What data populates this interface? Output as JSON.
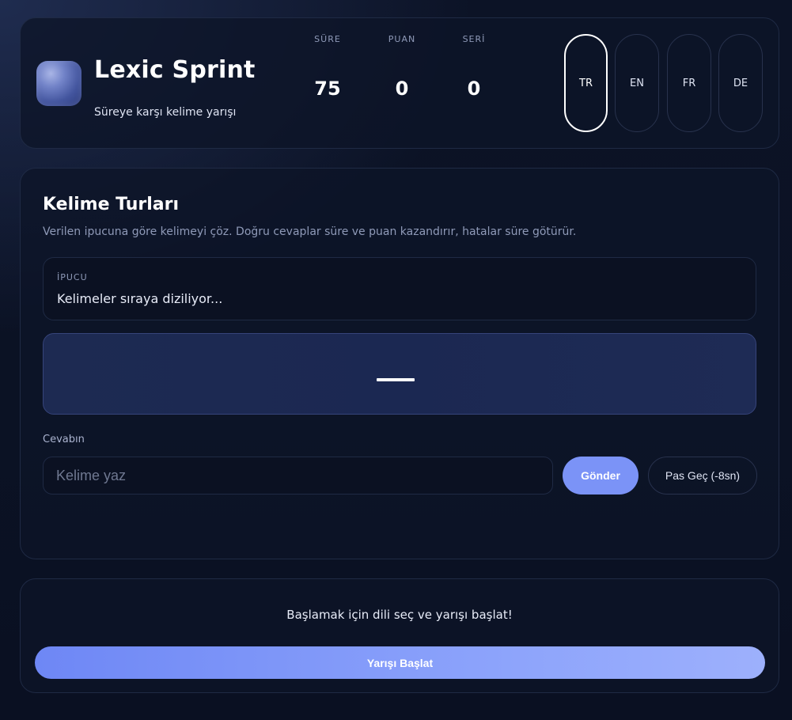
{
  "header": {
    "title": "Lexic Sprint",
    "subtitle": "Süreye karşı kelime yarışı",
    "logo": "gradient-orb-logo"
  },
  "stats": {
    "time": {
      "label": "SÜRE",
      "value": "75"
    },
    "score": {
      "label": "PUAN",
      "value": "0"
    },
    "streak": {
      "label": "SERİ",
      "value": "0"
    }
  },
  "languages": {
    "selected": "TR",
    "items": [
      "TR",
      "EN",
      "FR",
      "DE"
    ]
  },
  "game": {
    "title": "Kelime Turları",
    "description": "Verilen ipucuna göre kelimeyi çöz. Doğru cevaplar süre ve puan kazandırır, hatalar süre götürür.",
    "hint_label": "İPUCU",
    "hint_text": "Kelimeler sıraya diziliyor...",
    "answer_label": "Cevabın",
    "answer_placeholder": "Kelime yaz",
    "answer_value": "",
    "submit_label": "Gönder",
    "skip_label": "Pas Geç (-8sn)"
  },
  "footer": {
    "message": "Başlamak için dili seç ve yarışı başlat!",
    "start_label": "Yarışı Başlat"
  },
  "colors": {
    "accent": "#7b93f7",
    "background": "#0b1224",
    "word_box": "#1d2a52"
  }
}
